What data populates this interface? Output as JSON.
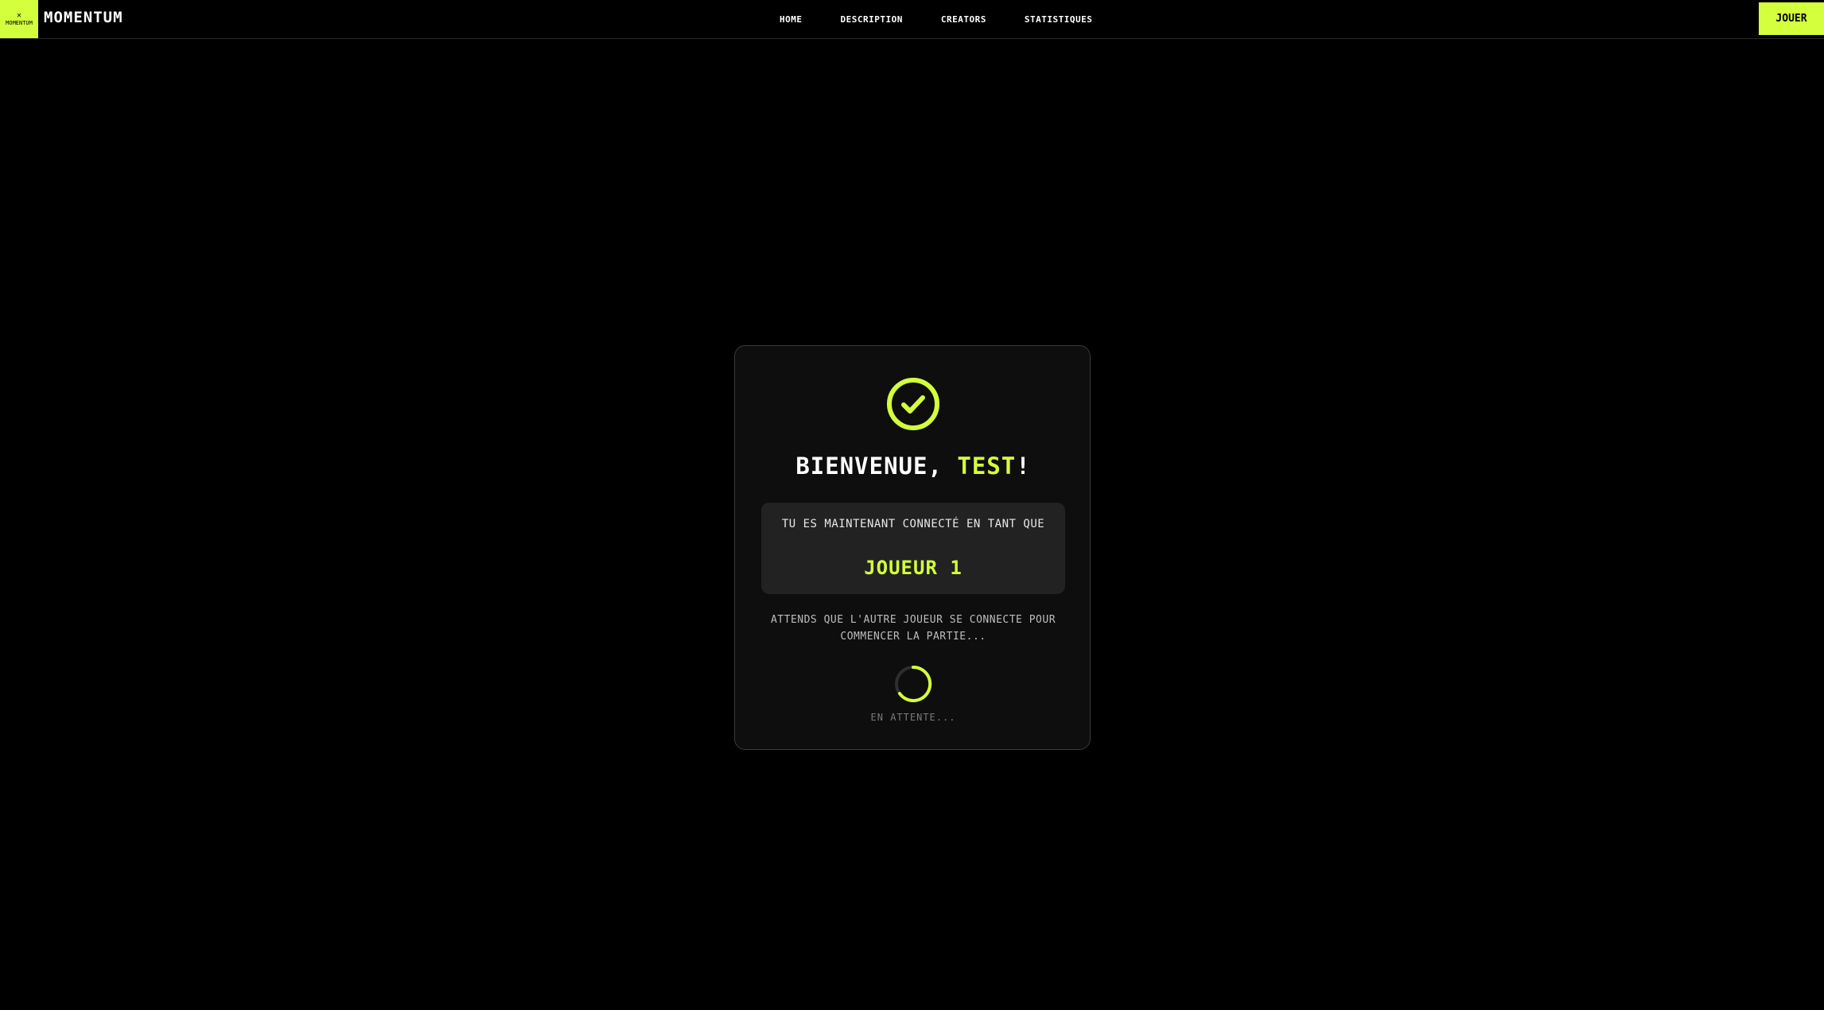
{
  "nav": {
    "logo_mark": "✕",
    "logo_text": "MOMENTUM",
    "brand": "MOMENTUM",
    "links": [
      "HOME",
      "DESCRIPTION",
      "CREATORS",
      "STATISTIQUES"
    ],
    "play_label": "JOUER"
  },
  "card": {
    "welcome_prefix": "BIENVENUE, ",
    "welcome_name": "TEST",
    "welcome_suffix": "!",
    "status_text": "TU ES MAINTENANT CONNECTÉ EN TANT QUE",
    "player": "JOUEUR 1",
    "wait_text": "ATTENDS QUE L'AUTRE JOUEUR SE CONNECTE POUR COMMENCER LA PARTIE...",
    "waiting_label": "EN ATTENTE..."
  },
  "colors": {
    "accent": "#d4ff3c",
    "background": "#000000",
    "card": "#0e0e0e",
    "status_box": "#222222"
  },
  "icons": {
    "check": "check-circle-icon",
    "spinner": "loading-spinner-icon"
  }
}
